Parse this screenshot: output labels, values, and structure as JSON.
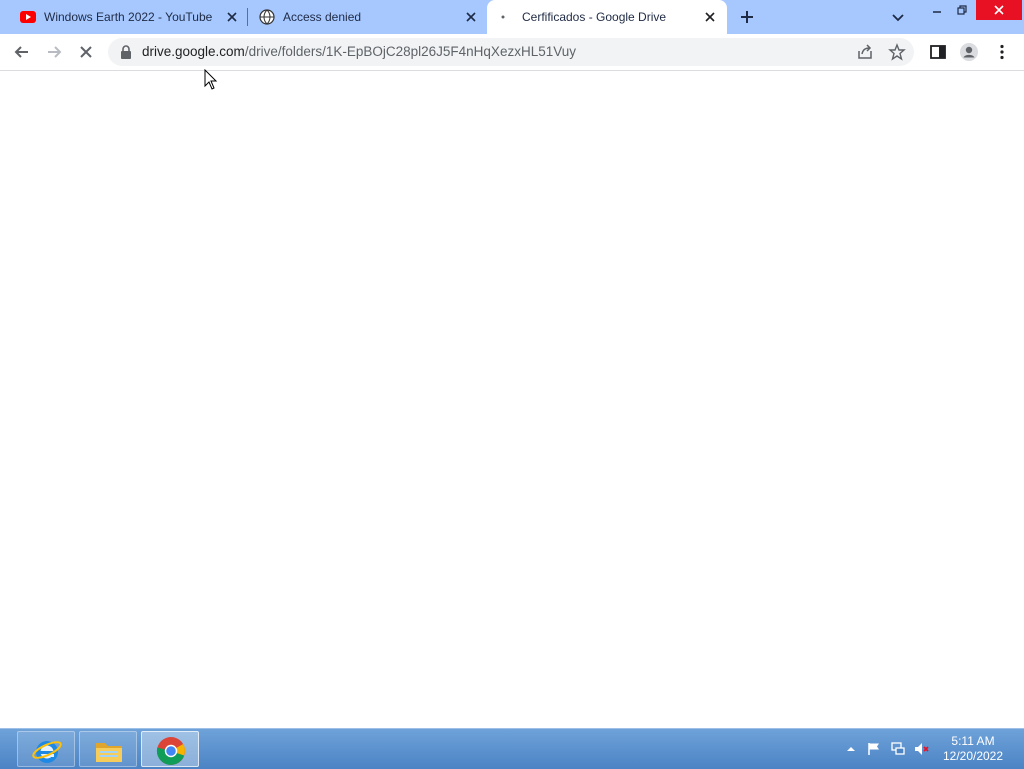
{
  "tabs": [
    {
      "title": "Windows Earth 2022 - YouTube",
      "icon": "youtube-icon"
    },
    {
      "title": "Access denied",
      "icon": "globe-icon"
    },
    {
      "title": "Cerfificados - Google Drive",
      "icon": "loading-icon",
      "active": true
    }
  ],
  "address_bar": {
    "url_domain": "drive.google.com",
    "url_path": "/drive/folders/1K-EpBOjC28pl26J5F4nHqXezxHL51Vuy"
  },
  "taskbar": {
    "apps": [
      "internet-explorer-icon",
      "file-explorer-icon",
      "chrome-icon"
    ],
    "time": "5:11 AM",
    "date": "12/20/2022"
  },
  "colors": {
    "tabstrip": "#a6c8ff",
    "taskbar": "#4b83c4",
    "close_red": "#e81123"
  }
}
